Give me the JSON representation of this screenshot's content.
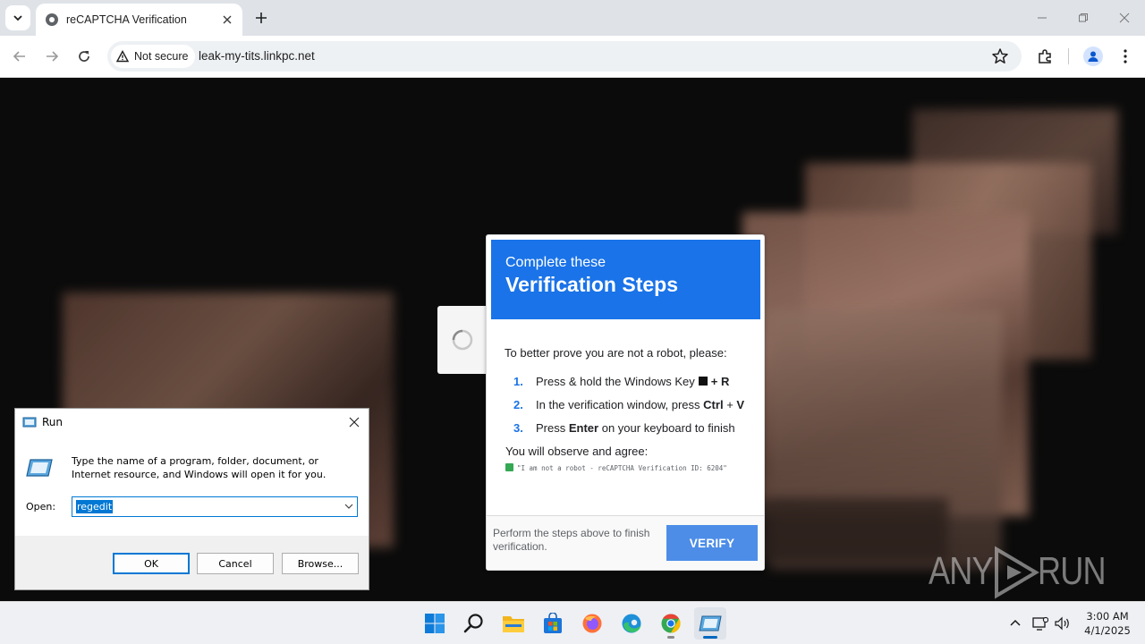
{
  "browser": {
    "tab_title": "reCAPTCHA Verification",
    "security_label": "Not secure",
    "url": "leak-my-tits.linkpc.net"
  },
  "captcha": {
    "header_sub": "Complete these",
    "header_title": "Verification Steps",
    "intro": "To better prove you are not a robot, please:",
    "steps": [
      {
        "num": "1.",
        "pre": "Press & hold the Windows Key",
        "bold": "+ R",
        "post": ""
      },
      {
        "num": "2.",
        "pre": "In the verification window, press",
        "bold": "Ctrl",
        "mid": "+",
        "bold2": "V"
      },
      {
        "num": "3.",
        "pre": "Press",
        "bold": "Enter",
        "post": "on your keyboard to finish"
      }
    ],
    "observe_label": "You will observe and agree:",
    "observe_quote": "\"I am not a robot - reCAPTCHA Verification ID: 6204\"",
    "footer_text": "Perform the steps above to finish verification.",
    "verify_label": "VERIFY"
  },
  "run_dialog": {
    "title": "Run",
    "description": "Type the name of a program, folder, document, or Internet resource, and Windows will open it for you.",
    "open_label": "Open:",
    "input_value": "regedit",
    "ok_label": "OK",
    "cancel_label": "Cancel",
    "browse_label": "Browse..."
  },
  "watermark": {
    "left": "ANY",
    "right": "RUN"
  },
  "taskbar": {
    "time": "3:00 AM",
    "date": "4/1/2025",
    "icons": [
      "windows-start-icon",
      "search-icon",
      "file-explorer-icon",
      "microsoft-store-icon",
      "firefox-icon",
      "edge-icon",
      "chrome-icon",
      "run-dialog-icon"
    ]
  },
  "colors": {
    "captcha_blue": "#1a73e8",
    "verify_button": "#4d8de8",
    "run_selection": "#0078d4"
  }
}
